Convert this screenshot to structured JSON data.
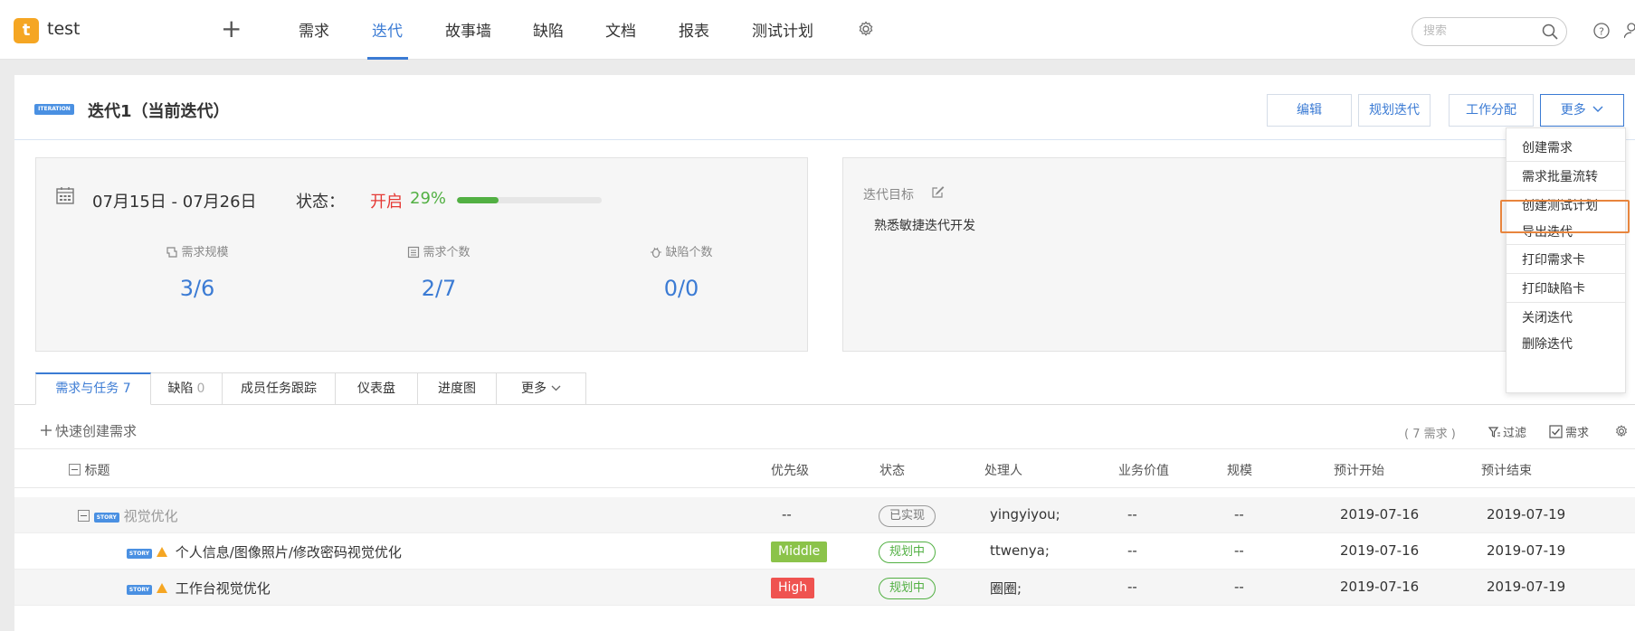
{
  "topbar": {
    "logo_letter": "t",
    "project": "test",
    "plus": "+",
    "nav": [
      "需求",
      "迭代",
      "故事墙",
      "缺陷",
      "文档",
      "报表",
      "测试计划"
    ],
    "active_nav": "迭代",
    "search_placeholder": "搜索",
    "accent": "#3b7bd4"
  },
  "iteration": {
    "badge": "ITERATION",
    "title": "迭代1（当前迭代）",
    "buttons": {
      "edit": "编辑",
      "plan": "规划迭代",
      "assign": "工作分配",
      "more": "更多"
    }
  },
  "stats": {
    "dates": "07月15日  -  07月26日",
    "status_label": "状态：",
    "status_value": "开启",
    "progress_label": "29%",
    "progress_value": 0.29,
    "items": [
      {
        "label": "需求规模",
        "value": "3/6",
        "icon": "ruler-icon"
      },
      {
        "label": "需求个数",
        "value": "2/7",
        "icon": "list-icon"
      },
      {
        "label": "缺陷个数",
        "value": "0/0",
        "icon": "bug-icon"
      }
    ]
  },
  "goal": {
    "label": "迭代目标",
    "text": "熟悉敏捷迭代开发"
  },
  "tabs": [
    {
      "label": "需求与任务 7",
      "count": ""
    },
    {
      "label": "缺陷",
      "count": "0"
    },
    {
      "label": "成员任务跟踪",
      "count": ""
    },
    {
      "label": "仪表盘",
      "count": ""
    },
    {
      "label": "进度图",
      "count": ""
    },
    {
      "label": "更多",
      "count": ""
    }
  ],
  "toolbar": {
    "quick_create": "快速创建需求",
    "req_count": "( 7 需求 )",
    "filter": "过滤",
    "req_toggle": "需求"
  },
  "table": {
    "columns": [
      "标题",
      "优先级",
      "状态",
      "处理人",
      "业务价值",
      "规模",
      "预计开始",
      "预计结束"
    ],
    "rows": [
      {
        "tag": "STORY",
        "title": "视觉优化",
        "priority": "--",
        "status": "已实现",
        "owner": "yingyiyou;",
        "value": "--",
        "size": "--",
        "start": "2019-07-16",
        "end": "2019-07-19"
      },
      {
        "tag": "STORY",
        "title": "个人信息/图像照片/修改密码视觉优化",
        "priority": "Middle",
        "status": "规划中",
        "owner": "ttwenya;",
        "value": "--",
        "size": "--",
        "start": "2019-07-16",
        "end": "2019-07-19"
      },
      {
        "tag": "STORY",
        "title": "工作台视觉优化",
        "priority": "High",
        "status": "规划中",
        "owner": "圈圈;",
        "value": "--",
        "size": "--",
        "start": "2019-07-16",
        "end": "2019-07-19"
      }
    ],
    "priority_colors": {
      "Middle": "#8bc34a",
      "High": "#ef5350"
    }
  },
  "more_menu": {
    "items": [
      "创建需求",
      "需求批量流转",
      "创建测试计划",
      "导出迭代",
      "打印需求卡",
      "打印缺陷卡",
      "关闭迭代",
      "删除迭代"
    ],
    "highlighted": "创建测试计划",
    "highlight_color": "#e8853d"
  }
}
